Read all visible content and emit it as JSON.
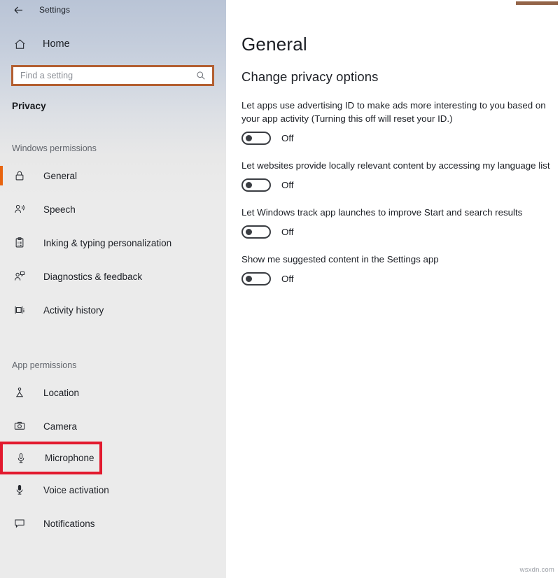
{
  "window": {
    "title": "Settings",
    "back_icon": "back-arrow-icon"
  },
  "sidebar": {
    "home": {
      "label": "Home",
      "icon": "home-icon"
    },
    "search": {
      "value": "",
      "placeholder": "Find a setting",
      "icon": "search-icon"
    },
    "category": "Privacy",
    "accent_color": "#e8640f",
    "highlight_color": "#b35f31",
    "groups": [
      {
        "label": "Windows permissions",
        "items": [
          {
            "label": "General",
            "icon": "lock-icon",
            "selected": true,
            "boxed": false
          },
          {
            "label": "Speech",
            "icon": "speech-person-icon",
            "selected": false,
            "boxed": false
          },
          {
            "label": "Inking & typing personalization",
            "icon": "clipboard-icon",
            "selected": false,
            "boxed": false
          },
          {
            "label": "Diagnostics & feedback",
            "icon": "person-feedback-icon",
            "selected": false,
            "boxed": false
          },
          {
            "label": "Activity history",
            "icon": "activity-history-icon",
            "selected": false,
            "boxed": false
          }
        ]
      },
      {
        "label": "App permissions",
        "items": [
          {
            "label": "Location",
            "icon": "location-pin-icon",
            "selected": false,
            "boxed": false
          },
          {
            "label": "Camera",
            "icon": "camera-icon",
            "selected": false,
            "boxed": false
          },
          {
            "label": "Microphone",
            "icon": "microphone-icon",
            "selected": false,
            "boxed": true
          },
          {
            "label": "Voice activation",
            "icon": "voice-activation-icon",
            "selected": false,
            "boxed": false
          },
          {
            "label": "Notifications",
            "icon": "notification-bubble-icon",
            "selected": false,
            "boxed": false
          }
        ]
      }
    ],
    "box_highlight_color": "#e2192e"
  },
  "main": {
    "page_title": "General",
    "section_title": "Change privacy options",
    "settings": [
      {
        "description": "Let apps use advertising ID to make ads more interesting to you based on your app activity (Turning this off will reset your ID.)",
        "state": "Off",
        "on": false
      },
      {
        "description": "Let websites provide locally relevant content by accessing my language list",
        "state": "Off",
        "on": false
      },
      {
        "description": "Let Windows track app launches to improve Start and search results",
        "state": "Off",
        "on": false
      },
      {
        "description": "Show me suggested content in the Settings app",
        "state": "Off",
        "on": false
      }
    ]
  },
  "watermark": "wsxdn.com"
}
